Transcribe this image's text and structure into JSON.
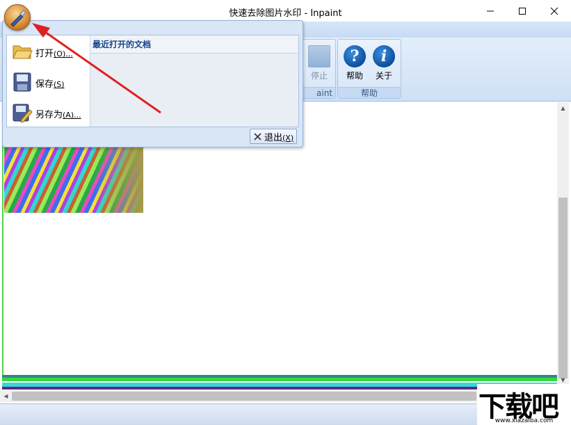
{
  "window": {
    "title": "快速去除图片水印 - Inpaint"
  },
  "ribbon": {
    "groups": [
      {
        "label": "aint"
      },
      {
        "label": "帮助"
      }
    ],
    "buttons": {
      "stop": "停止",
      "help": "帮助",
      "about": "关于"
    }
  },
  "app_menu": {
    "items": [
      {
        "label": "打开",
        "accel": "(O)..."
      },
      {
        "label": "保存",
        "accel": "(S)"
      },
      {
        "label": "另存为",
        "accel": "(A)..."
      }
    ],
    "recent_title": "最近打开的文档",
    "exit": {
      "label": "退出",
      "accel": "(X)"
    }
  },
  "watermark": {
    "logo": "下载吧",
    "url": "www.xiazaiba.com"
  },
  "colors": {
    "ribbon": "#cfe0f5",
    "accent": "#15428b",
    "arrow": "#e02020",
    "canvas_edge": "#4fd14f"
  }
}
